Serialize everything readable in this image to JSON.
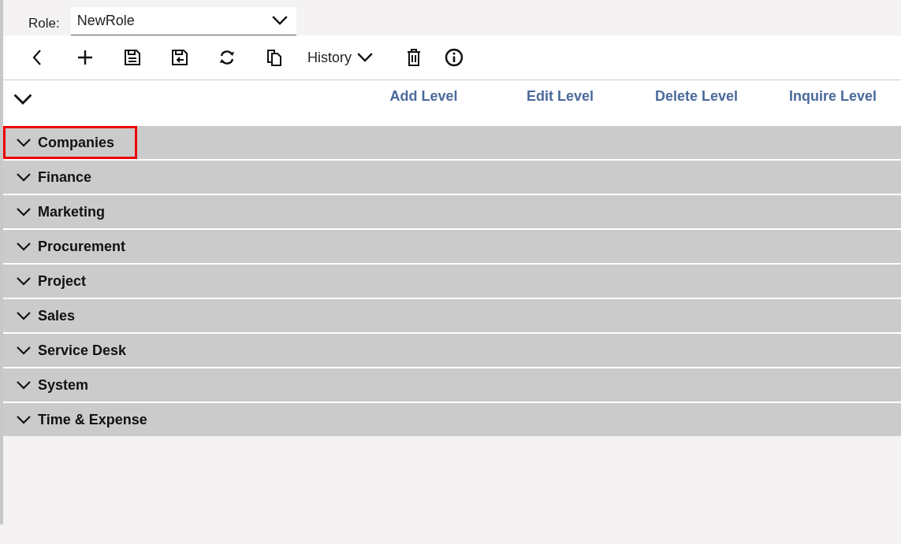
{
  "role": {
    "label": "Role:",
    "value": "NewRole"
  },
  "toolbar": [
    {
      "kind": "back"
    },
    {
      "kind": "add"
    },
    {
      "kind": "save"
    },
    {
      "kind": "save-return"
    },
    {
      "kind": "refresh"
    },
    {
      "kind": "copy"
    },
    {
      "kind": "history",
      "label": "History"
    },
    {
      "kind": "delete"
    },
    {
      "kind": "info"
    }
  ],
  "level_actions": [
    "Add Level",
    "Edit Level",
    "Delete Level",
    "Inquire Level"
  ],
  "sections": [
    {
      "label": "Companies",
      "highlighted": true
    },
    {
      "label": "Finance",
      "highlighted": false
    },
    {
      "label": "Marketing",
      "highlighted": false
    },
    {
      "label": "Procurement",
      "highlighted": false
    },
    {
      "label": "Project",
      "highlighted": false
    },
    {
      "label": "Sales",
      "highlighted": false
    },
    {
      "label": "Service Desk",
      "highlighted": false
    },
    {
      "label": "System",
      "highlighted": false
    },
    {
      "label": "Time & Expense",
      "highlighted": false
    }
  ]
}
